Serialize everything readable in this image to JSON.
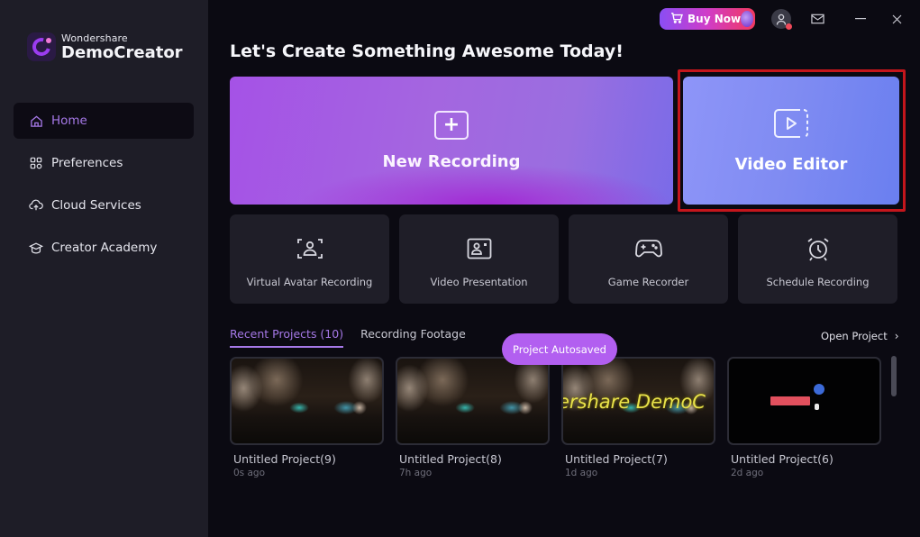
{
  "app": {
    "brand": "Wondershare",
    "product": "DemoCreator"
  },
  "sidebar": {
    "items": [
      {
        "label": "Home",
        "icon": "home-icon",
        "active": true
      },
      {
        "label": "Preferences",
        "icon": "grid-icon",
        "active": false
      },
      {
        "label": "Cloud Services",
        "icon": "cloud-upload-icon",
        "active": false
      },
      {
        "label": "Creator Academy",
        "icon": "graduation-cap-icon",
        "active": false
      }
    ]
  },
  "topbar": {
    "buy_label": "Buy Now",
    "icons": [
      "cart-icon",
      "user-avatar-icon",
      "mail-icon",
      "minimize-icon",
      "close-icon"
    ]
  },
  "main": {
    "headline": "Let's Create Something Awesome Today!",
    "primary_cards": [
      {
        "label": "New Recording",
        "icon": "plus-square-icon"
      },
      {
        "label": "Video Editor",
        "icon": "play-square-icon",
        "highlighted": true
      }
    ],
    "tools": [
      {
        "label": "Virtual Avatar Recording",
        "icon": "avatar-scan-icon"
      },
      {
        "label": "Video Presentation",
        "icon": "presentation-icon"
      },
      {
        "label": "Game Recorder",
        "icon": "gamepad-icon"
      },
      {
        "label": "Schedule Recording",
        "icon": "alarm-clock-icon"
      }
    ],
    "tabs": [
      {
        "label": "Recent Projects (10)",
        "active": true
      },
      {
        "label": "Recording Footage",
        "active": false
      }
    ],
    "toast": "Project Autosaved",
    "open_project_label": "Open Project",
    "projects": [
      {
        "name": "Untitled Project(9)",
        "time": "0s ago",
        "thumb": "street"
      },
      {
        "name": "Untitled Project(8)",
        "time": "7h ago",
        "thumb": "street"
      },
      {
        "name": "Untitled Project(7)",
        "time": "1d ago",
        "thumb": "street-text",
        "overlay_text": "ershare DemoC"
      },
      {
        "name": "Untitled Project(6)",
        "time": "2d ago",
        "thumb": "black"
      }
    ]
  },
  "colors": {
    "accent": "#a679e8",
    "highlight_border": "#c4161c",
    "toast_bg": "#b25ff0",
    "sidebar_bg": "#1e1d27",
    "main_bg": "#0b0a12"
  }
}
